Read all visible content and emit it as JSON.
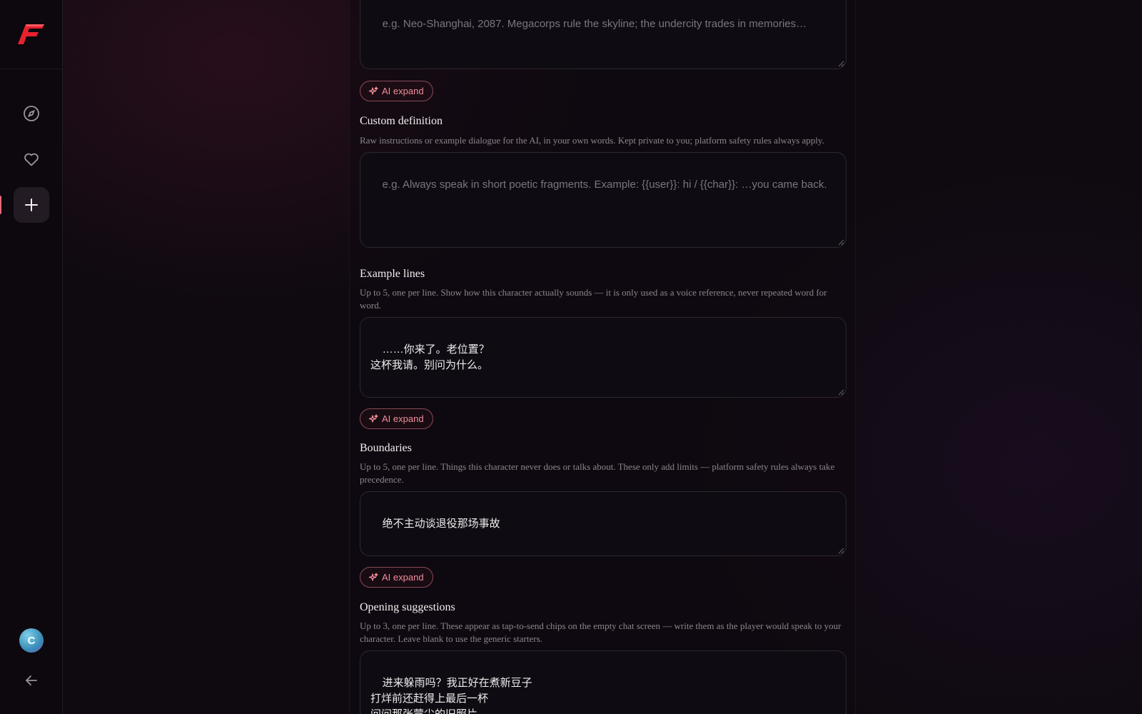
{
  "sidebar": {
    "logo_letter": "F",
    "avatar_initial": "C",
    "nav": [
      {
        "name": "compass-icon"
      },
      {
        "name": "heart-icon"
      },
      {
        "name": "plus-icon",
        "active": true
      }
    ]
  },
  "form": {
    "world": {
      "placeholder": "e.g. Neo-Shanghai, 2087. Megacorps rule the skyline; the undercity trades in memories…"
    },
    "ai_expand_label": "AI expand",
    "custom_definition": {
      "label": "Custom definition",
      "help": "Raw instructions or example dialogue for the AI, in your own words. Kept private to you; platform safety rules always apply.",
      "placeholder": "e.g. Always speak in short poetic fragments. Example: {{user}}: hi / {{char}}: …you came back."
    },
    "example_lines": {
      "label": "Example lines",
      "help": "Up to 5, one per line. Show how this character actually sounds — it is only used as a voice reference, never repeated word for word.",
      "value": "……你来了。老位置？\n这杯我请。别问为什么。"
    },
    "boundaries": {
      "label": "Boundaries",
      "help": "Up to 5, one per line. Things this character never does or talks about. These only add limits — platform safety rules always take precedence.",
      "value": "绝不主动谈退役那场事故"
    },
    "opening_suggestions": {
      "label": "Opening suggestions",
      "help": "Up to 3, one per line. These appear as tap-to-send chips on the empty chat screen — write them as the player would speak to your character. Leave blank to use the generic starters.",
      "value": "进来躲雨吗？我正好在煮新豆子\n打烊前还赶得上最后一杯\n问问那张蒙尘的旧照片"
    }
  },
  "colors": {
    "accent": "#e66a7a",
    "background": "#0f0a10"
  }
}
